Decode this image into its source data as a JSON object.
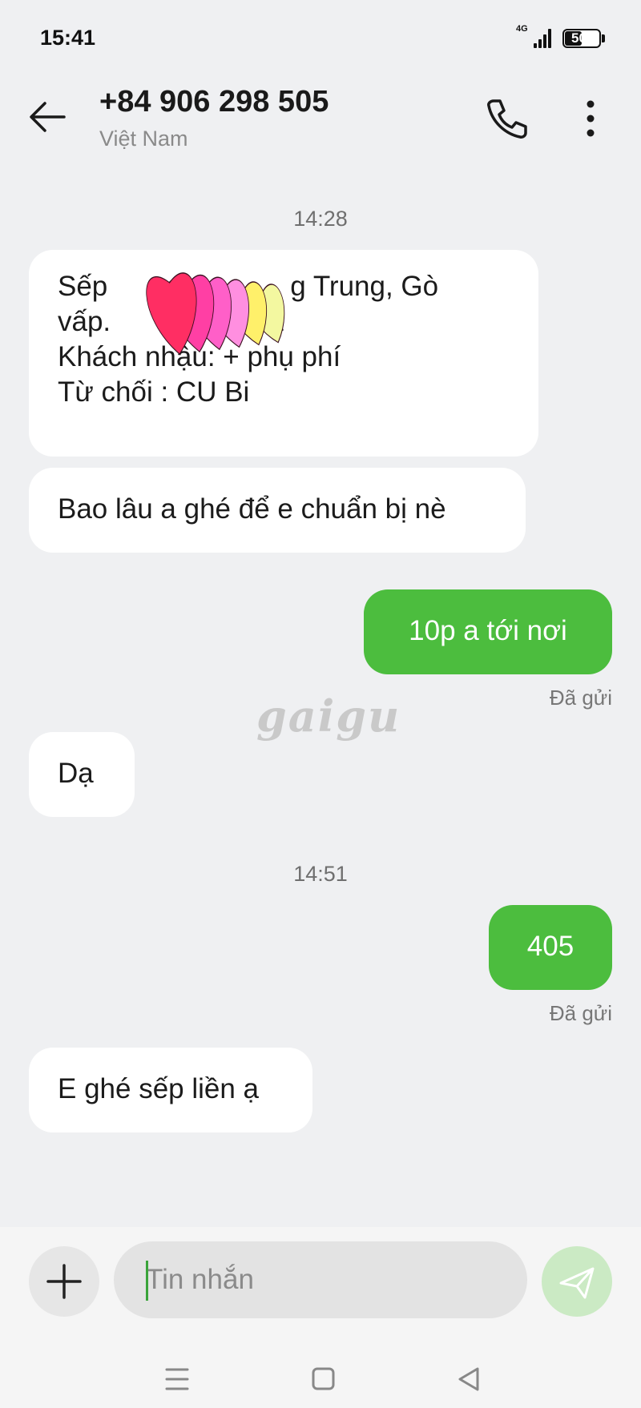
{
  "status_bar": {
    "time": "15:41",
    "network": "4G",
    "battery": "50",
    "battery_level": 0.5
  },
  "header": {
    "contact_number": "+84 906 298 505",
    "contact_region": "Việt Nam",
    "back_icon": "arrow-left-icon",
    "call_icon": "phone-icon",
    "more_icon": "more-vertical-icon"
  },
  "conversation": {
    "groups": [
      {
        "timestamp": "14:28",
        "messages": [
          {
            "direction": "incoming",
            "lines": [
              "Sếp",
              "g Trung, Gò",
              "vấp.",
              "ạ",
              "Khách nhậu: + phụ phí",
              "Từ chối : CU Bi"
            ]
          },
          {
            "direction": "incoming",
            "text": "Bao lâu a ghé để e chuẩn bị nè"
          },
          {
            "direction": "outgoing",
            "text": "10p a tới nơi",
            "status": "Đã gửi"
          },
          {
            "direction": "incoming",
            "text": "Dạ"
          }
        ]
      },
      {
        "timestamp": "14:51",
        "messages": [
          {
            "direction": "outgoing",
            "text": "405",
            "status": "Đã gửi"
          },
          {
            "direction": "incoming",
            "text": "E ghé sếp liền ạ"
          }
        ]
      }
    ]
  },
  "watermark": "gaigu",
  "overlay": {
    "icon": "hearts-sticker-icon",
    "colors": [
      "#ff2e63",
      "#ff3fa4",
      "#ff5fc8",
      "#ff8fe0",
      "#fff06a",
      "#f3f8a0"
    ]
  },
  "composer": {
    "placeholder": "Tin nhắn",
    "attach_icon": "plus-icon",
    "send_icon": "send-icon"
  },
  "navigation": {
    "menu_icon": "menu-icon",
    "home_icon": "home-square-icon",
    "back_icon": "back-triangle-icon"
  },
  "colors": {
    "outgoing_bubble": "#4cbd3e",
    "incoming_bubble": "#ffffff",
    "background": "#eff0f2",
    "send_button": "#cbeac4"
  }
}
